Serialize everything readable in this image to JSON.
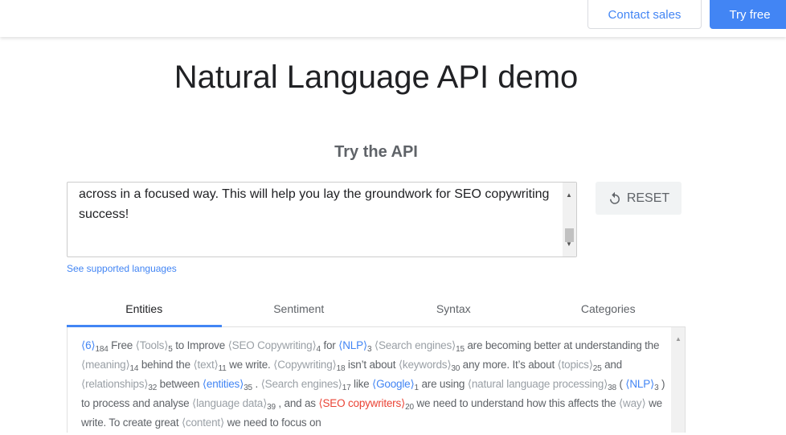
{
  "header": {
    "contact_label": "Contact sales",
    "try_label": "Try free"
  },
  "title": "Natural Language API demo",
  "subtitle": "Try the API",
  "input": {
    "value": "across in a focused way. This will help you lay the groundwork for SEO copywriting success!"
  },
  "reset_label": "RESET",
  "supported_languages_link": "See supported languages",
  "tabs": [
    {
      "label": "Entities"
    },
    {
      "label": "Sentiment"
    },
    {
      "label": "Syntax"
    },
    {
      "label": "Categories"
    }
  ],
  "colors": {
    "accent": "#4285f4",
    "entity_gray": "#9aa0a6",
    "entity_red": "#ea4335"
  },
  "entities_text": [
    {
      "e": "6",
      "n": "184",
      "c": "blue"
    },
    {
      "t": " Free "
    },
    {
      "e": "Tools",
      "n": "5"
    },
    {
      "t": " to Improve "
    },
    {
      "e": "SEO Copywriting",
      "n": "4"
    },
    {
      "t": " for "
    },
    {
      "e": "NLP",
      "n": "3",
      "c": "blue"
    },
    {
      "t": " "
    },
    {
      "e": "Search engines",
      "n": "15"
    },
    {
      "t": " are becoming better at understanding the "
    },
    {
      "e": "meaning",
      "n": "14"
    },
    {
      "t": " behind the "
    },
    {
      "e": "text",
      "n": "11"
    },
    {
      "t": " we write. "
    },
    {
      "e": "Copywriting",
      "n": "18"
    },
    {
      "t": " isn’t about "
    },
    {
      "e": "keywords",
      "n": "30"
    },
    {
      "t": " any more. It’s about "
    },
    {
      "e": "topics",
      "n": "25"
    },
    {
      "t": " and "
    },
    {
      "e": "relationships",
      "n": "32"
    },
    {
      "t": " between "
    },
    {
      "e": "entities",
      "n": "35",
      "c": "blue"
    },
    {
      "t": " . "
    },
    {
      "e": "Search engines",
      "n": "17"
    },
    {
      "t": " like "
    },
    {
      "e": "Google",
      "n": "1",
      "c": "blue"
    },
    {
      "t": " are using "
    },
    {
      "e": "natural language processing",
      "n": "38"
    },
    {
      "t": " ( "
    },
    {
      "e": "NLP",
      "n": "3",
      "c": "blue"
    },
    {
      "t": " ) to process and analyse "
    },
    {
      "e": "language data",
      "n": "39"
    },
    {
      "t": " , and as "
    },
    {
      "e": "SEO copywriters",
      "n": "20",
      "c": "red"
    },
    {
      "t": " we need to understand how this affects the "
    },
    {
      "e": "way",
      "n": ""
    },
    {
      "t": " we write. To create great "
    },
    {
      "e": "content",
      "n": ""
    },
    {
      "t": " we need to focus on"
    }
  ]
}
